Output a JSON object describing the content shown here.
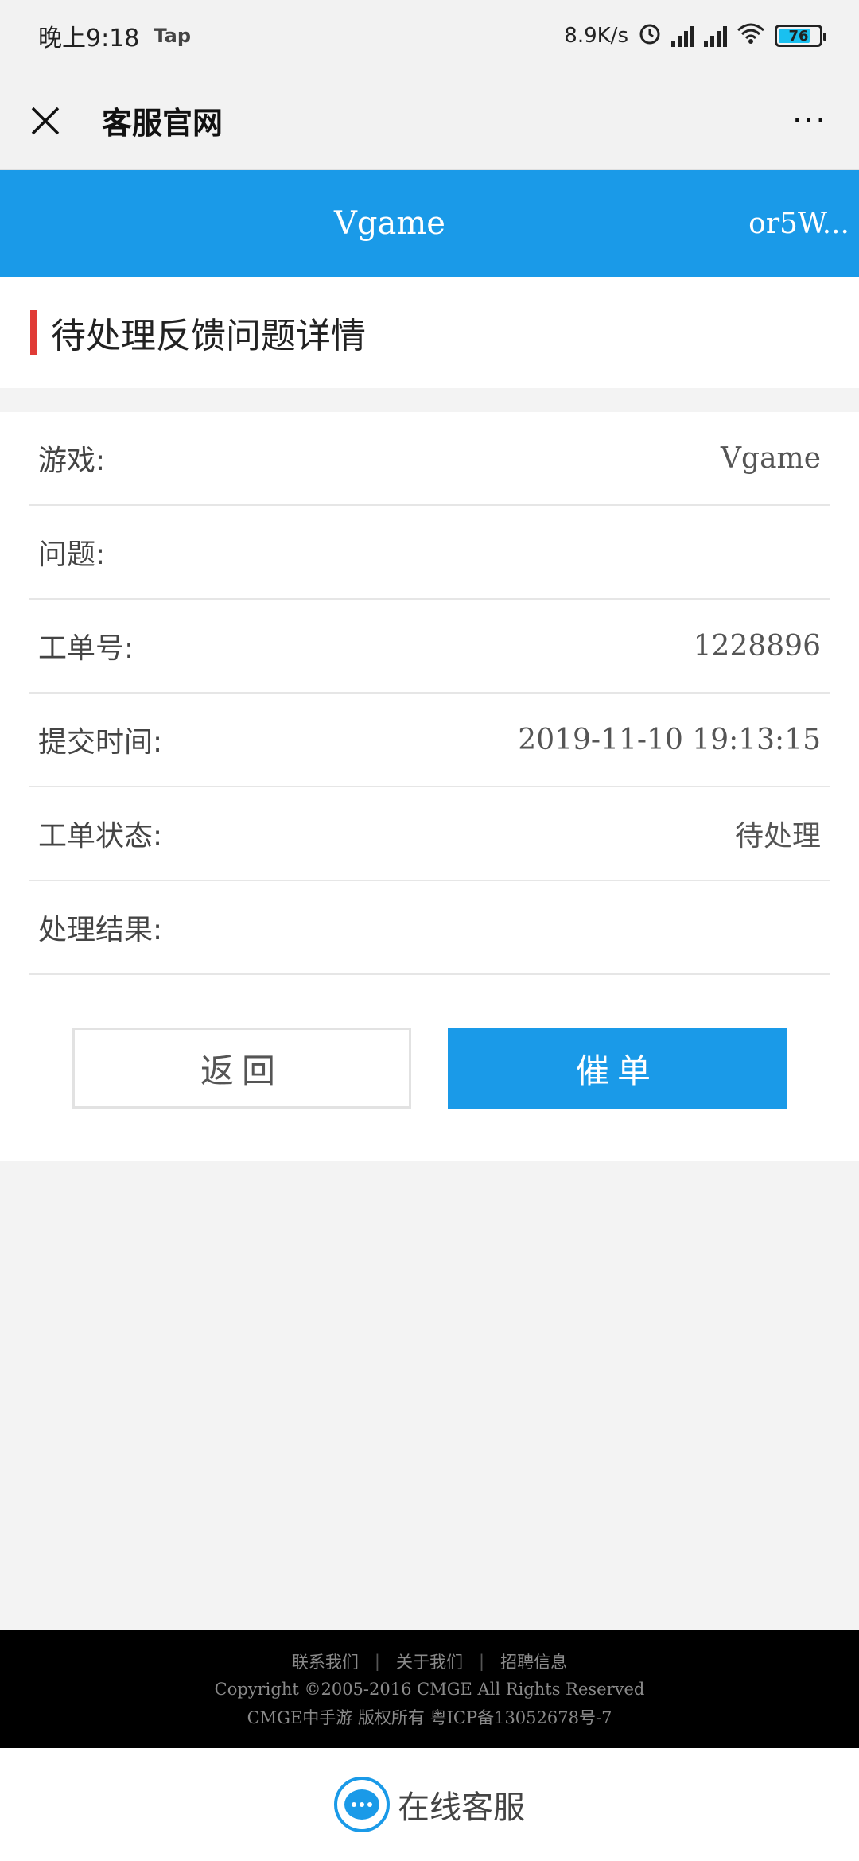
{
  "status_bar": {
    "time": "晚上9:18",
    "app_badge": "Tap",
    "net_speed": "8.9K/s",
    "battery": "76"
  },
  "title_bar": {
    "title": "客服官网",
    "more": "···"
  },
  "header": {
    "game_title": "Vgame",
    "user": "or5W..."
  },
  "section": {
    "title": "待处理反馈问题详情"
  },
  "details": {
    "game_label": "游戏:",
    "game_value": "Vgame",
    "issue_label": "问题:",
    "issue_value": "",
    "ticket_label": "工单号:",
    "ticket_value": "1228896",
    "submit_label": "提交时间:",
    "submit_value": "2019-11-10 19:13:15",
    "status_label": "工单状态:",
    "status_value": "待处理",
    "result_label": "处理结果:",
    "result_value": ""
  },
  "buttons": {
    "back": "返回",
    "urge": "催单"
  },
  "footer": {
    "link_contact": "联系我们",
    "link_about": "关于我们",
    "link_jobs": "招聘信息",
    "separator": "|",
    "copyright": "Copyright ©2005-2016 CMGE All Rights Reserved",
    "icp": "CMGE中手游 版权所有 粤ICP备13052678号-7"
  },
  "bottom": {
    "online_service": "在线客服"
  },
  "colors": {
    "brand_blue": "#1a9ae8",
    "accent_red": "#e03b36"
  }
}
